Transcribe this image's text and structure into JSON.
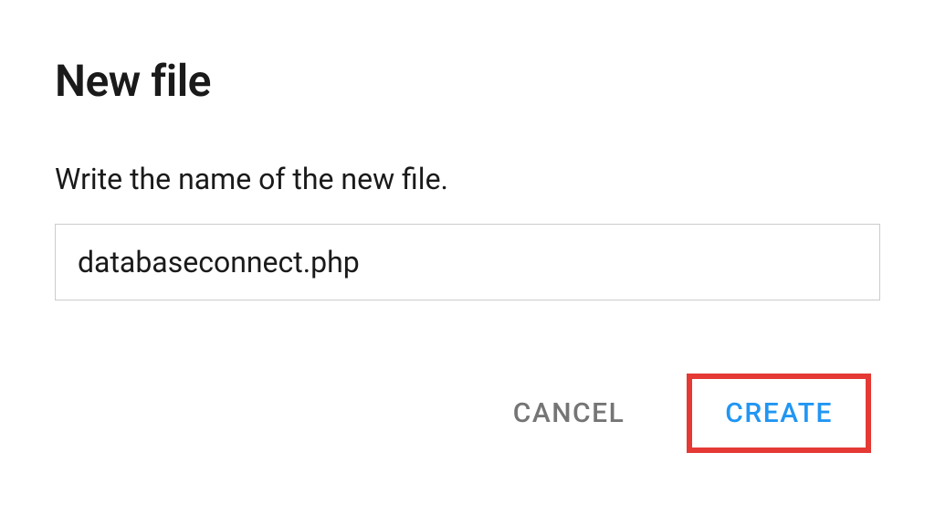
{
  "dialog": {
    "title": "New file",
    "prompt": "Write the name of the new file.",
    "filename_value": "databaseconnect.php",
    "cancel_label": "CANCEL",
    "create_label": "CREATE"
  }
}
